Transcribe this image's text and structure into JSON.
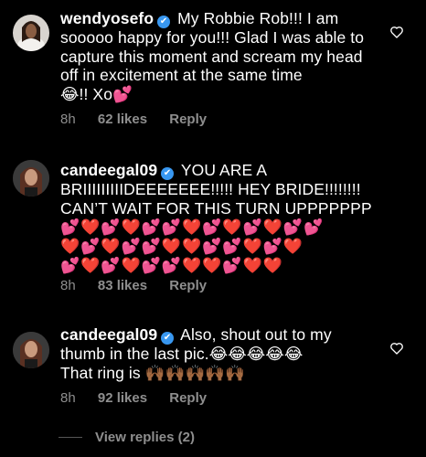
{
  "comments": [
    {
      "username": "wendyosefo",
      "verified_icon": "✔",
      "text": "My Robbie Rob!!! I am sooooo happy for you!!! Glad I was able to capture this moment and scream my head off in excitement at the same time",
      "text_tail": "😂!! Xo💕",
      "time": "8h",
      "likes": "62 likes",
      "reply": "Reply"
    },
    {
      "username": "candeegal09",
      "verified_icon": "✔",
      "text": "YOU ARE A BRIIIIIIIIIDEEEEEEE!!!!! HEY BRIDE!!!!!!!! CAN’T WAIT FOR THIS TURN UPPPPPPP",
      "emoji_rows": [
        "💕❤️💕❤️💕💕❤️💕❤️💕❤️💕💕",
        "❤️💕❤️💕💕❤️❤️💕💕❤️💕❤️",
        "💕❤️💕❤️💕💕❤️❤️💕❤️❤️"
      ],
      "time": "8h",
      "likes": "83 likes",
      "reply": "Reply"
    },
    {
      "username": "candeegal09",
      "verified_icon": "✔",
      "text": "Also, shout out to my thumb in the last pic.",
      "text_emojis": "😂😂😂😂😂",
      "text2": "That ring is",
      "text2_emojis": "🙌🏾🙌🏾🙌🏾🙌🏾🙌🏾",
      "time": "8h",
      "likes": "92 likes",
      "reply": "Reply"
    }
  ],
  "view_replies": "View replies (2)",
  "colors": {
    "background": "#000000",
    "text": "#ffffff",
    "secondary": "#8e8e8e",
    "verified": "#3897f0"
  },
  "icons": [
    "heart-outline-icon",
    "verified-badge-icon"
  ]
}
